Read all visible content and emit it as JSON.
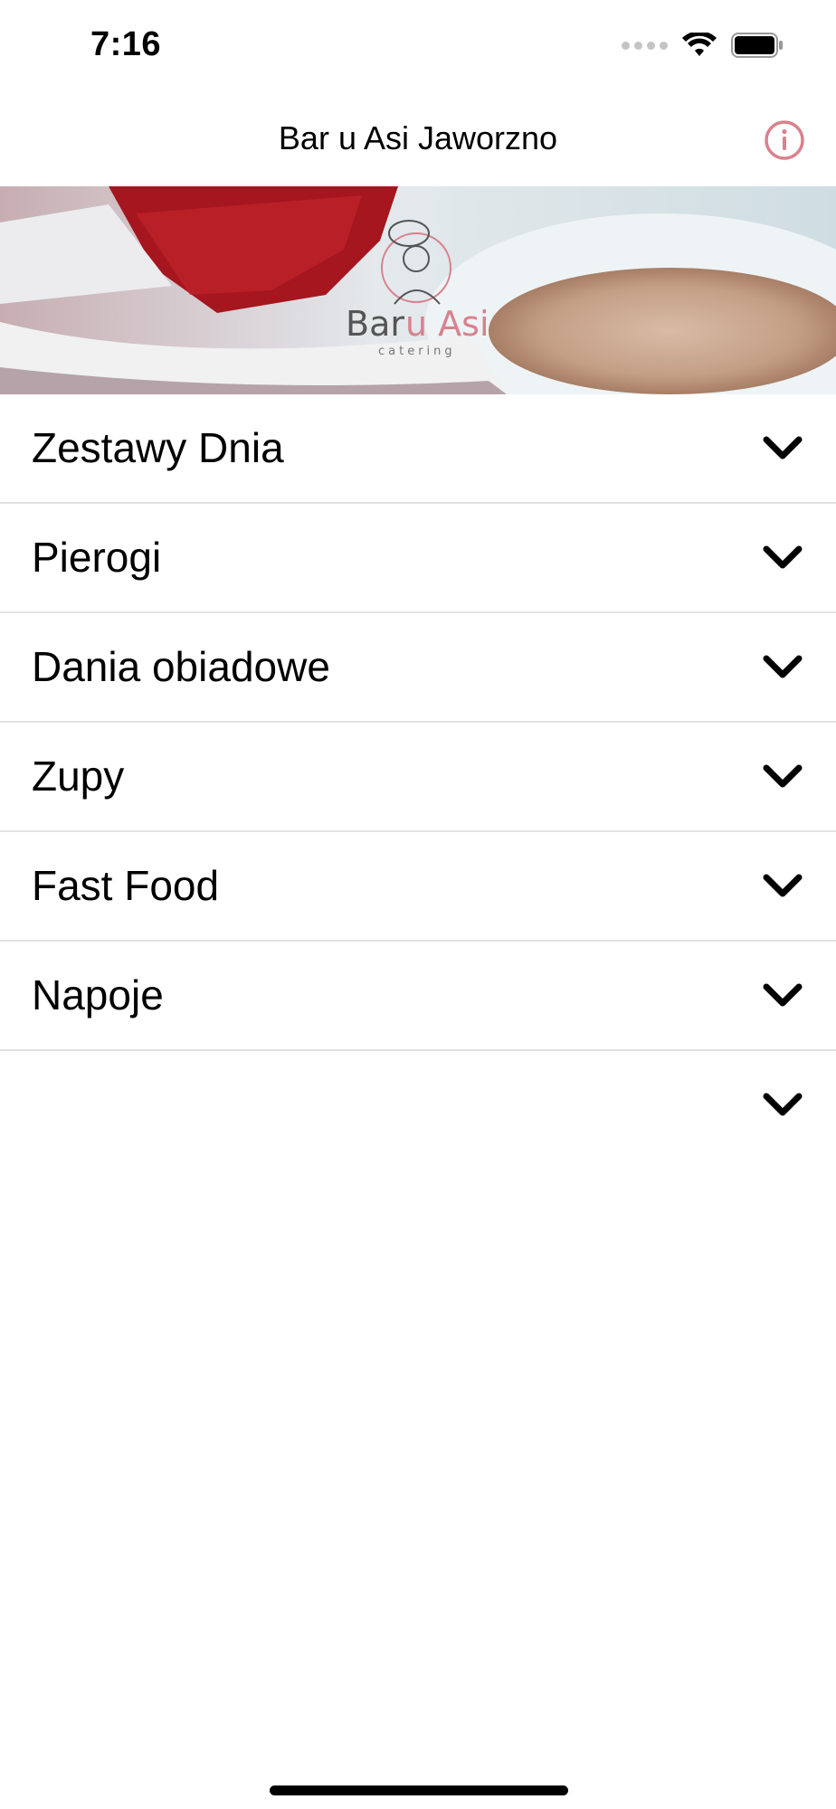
{
  "status_bar": {
    "time": "7:16"
  },
  "nav": {
    "title": "Bar u Asi Jaworzno",
    "info_icon": "info-circle-icon"
  },
  "banner": {
    "logo_text_bar": "Bar",
    "logo_text_uasi": "u Asi",
    "logo_subtitle": "catering"
  },
  "categories": [
    {
      "label": "Zestawy Dnia"
    },
    {
      "label": "Pierogi"
    },
    {
      "label": "Dania obiadowe"
    },
    {
      "label": "Zupy"
    },
    {
      "label": "Fast Food"
    },
    {
      "label": "Napoje"
    },
    {
      "label": ""
    }
  ],
  "colors": {
    "accent": "#d9818e",
    "divider": "#e2e2e2",
    "text": "#000000"
  }
}
